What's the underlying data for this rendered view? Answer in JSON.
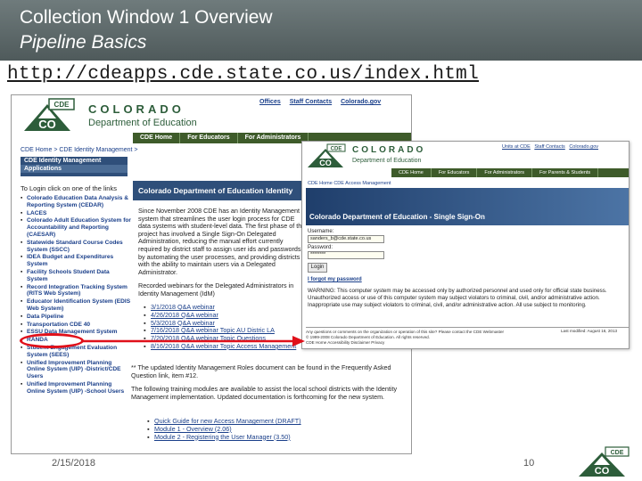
{
  "slide": {
    "title": "Collection Window 1 Overview",
    "subtitle": "Pipeline Basics",
    "url": "http://cdeapps.cde.state.co.us/index.html",
    "date": "2/15/2018",
    "page_number": "10"
  },
  "cde_home": {
    "logo_text": "CO",
    "logo_badge": "CDE",
    "state_name": "COLORADO",
    "department": "Department of Education",
    "top_links": [
      "Offices",
      "Staff Contacts",
      "Colorado.gov"
    ],
    "nav": [
      "CDE Home",
      "For Educators",
      "For Administrators"
    ],
    "breadcrumb": "CDE Home > CDE Identity Management >",
    "sidebar_header": "CDE Identity Management",
    "sidebar_sub": "Applications",
    "login_prompt": "To Login click on one of the links",
    "applications": [
      "Colorado Education Data Analysis & Reporting System (CEDAR)",
      "LACES",
      "Colorado Adult Education System for Accountability and Reporting (CAESAR)",
      "Statewide Standard Course Codes System (SSCC)",
      "IDEA Budget and Expenditures System",
      "Facility Schools Student Data System",
      "Record Integration Tracking System (RITS Web System)",
      "Educator Identification System (EDIS Web System)",
      "Data Pipeline",
      "Transportation CDE 40",
      "ESSU Data Management System",
      "RANDA",
      "Student Engagement Evaluation System (SEES)",
      "Unified Improvement Planning Online System (UIP) -District/CDE Users",
      "Unified Improvement Planning Online System (UIP) -School Users"
    ],
    "main_title": "Colorado Department of Education Identity",
    "intro_text": "Since November 2008 CDE has an Identity Management system that streamlines the user login process for CDE data systems with student-level data. The first phase of the project has involved a Single Sign-On Delegated Administration, reducing the manual effort currently required by district staff to assign user ids and passwords by automating the user processes, and providing districts with the ability to maintain users via a Delegated Administrator.",
    "recorded_text": "Recorded webinars for the Delegated Administrators in Identity Management (IdM)",
    "webinars": [
      "3/1/2018 Q&A webinar",
      "4/26/2018 Q&A webinar",
      "5/3/2018 Q&A webinar",
      "7/16/2018 Q&A webinar Topic AU Distric LA",
      "7/20/2018 Q&A webinar Topic Questions",
      "8/16/2018 Q&A webinar Topic Access Management"
    ],
    "note_text": "** The updated Identity Management Roles document can be found in the Frequently Asked Question link, item #12.",
    "training_text": "The following training modules are available to assist the local school districts with the Identity Management implementation. Updated documentation is forthcoming for the new system.",
    "guides": [
      "Quick Guide for new Access Management (DRAFT)",
      "Module 1 - Overview (2.06)",
      "Module 2 - Registering the User Manager (3.50)"
    ]
  },
  "sso": {
    "state_name": "COLORADO",
    "department": "Department of Education",
    "top_links": [
      "Units at CDE",
      "Staff Contacts",
      "Colorado.gov"
    ],
    "nav": [
      "CDE Home",
      "For Educators",
      "For Administrators",
      "For Parents & Students"
    ],
    "breadcrumb": "CDE Home  CDE Access Management",
    "band_title": "Colorado Department of Education - Single Sign-On",
    "username_label": "Username:",
    "username_value": "sanders_b@cde.state.co.us",
    "password_label": "Password:",
    "password_value": "********",
    "login_button": "Login",
    "forgot_link": "I forgot my password",
    "warning": "WARNING: This computer system may be accessed only by authorized personnel and used only for official state business. Unauthorized access or use of this computer system may subject violators to criminal, civil, and/or administrative action. Inappropriate use may subject violators to criminal, civil, and/or administrative action. All use subject to monitoring.",
    "footer_line1": "Any questions or comments on the organization or operation of this site? Please contact the CDE Webmaster",
    "footer_line2": "© 1999-2008 Colorado Department of Education. All rights reserved.",
    "footer_links": "CDE Home  Accessibility  Disclaimer  Privacy",
    "last_modified": "Last modified: August 16, 2013"
  },
  "colors": {
    "highlight": "#e0101a",
    "header_bg": "#5f6b6c",
    "co_green": "#2d5d3a",
    "co_blue": "#2f4f7a"
  }
}
